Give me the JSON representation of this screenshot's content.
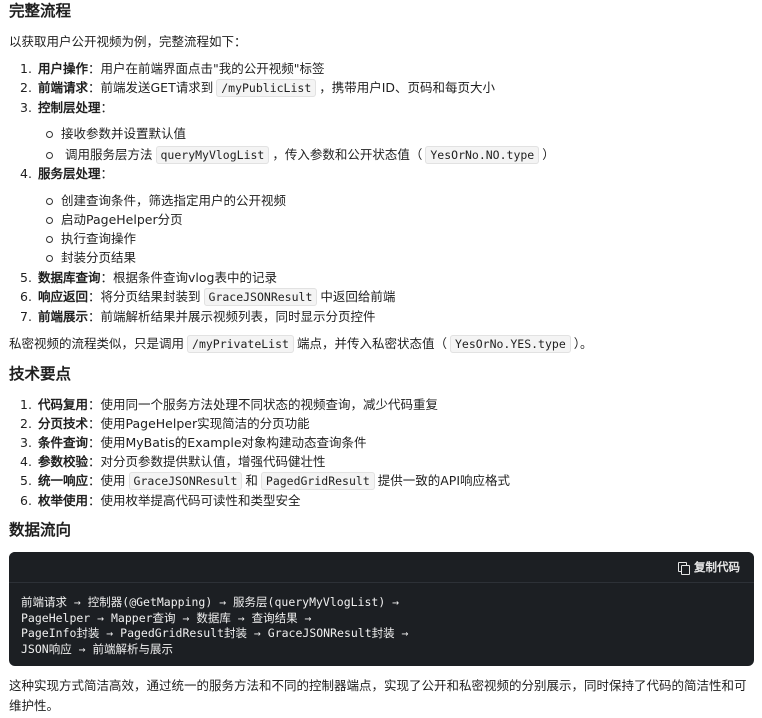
{
  "sections": {
    "flow_title": "完整流程",
    "tech_title": "技术要点",
    "data_title": "数据流向"
  },
  "intro": "以获取用户公开视频为例，完整流程如下：",
  "steps": [
    {
      "num": "1.",
      "label": "用户操作",
      "text": "：用户在前端界面点击\"我的公开视频\"标签"
    },
    {
      "num": "2.",
      "label": "前端请求",
      "pre": "：前端发送GET请求到",
      "code": "/myPublicList",
      "post": "，携带用户ID、页码和每页大小"
    },
    {
      "num": "3.",
      "label": "控制层处理",
      "text": "："
    },
    {
      "num": "4.",
      "label": "服务层处理",
      "text": "："
    },
    {
      "num": "5.",
      "label": "数据库查询",
      "text": "：根据条件查询vlog表中的记录"
    },
    {
      "num": "6.",
      "label": "响应返回",
      "pre": "：将分页结果封装到",
      "code": "GraceJSONResult",
      "post": "中返回给前端"
    },
    {
      "num": "7.",
      "label": "前端展示",
      "text": "：前端解析结果并展示视频列表，同时显示分页控件"
    }
  ],
  "controller_sub": {
    "item1": "接收参数并设置默认值",
    "item2_pre": "调用服务层方法",
    "item2_code1": "queryMyVlogList",
    "item2_mid": "，传入参数和公开状态值（",
    "item2_code2": "YesOrNo.NO.type",
    "item2_post": "）"
  },
  "service_sub": [
    "创建查询条件，筛选指定用户的公开视频",
    "启动PageHelper分页",
    "执行查询操作",
    "封装分页结果"
  ],
  "private_note": {
    "pre": "私密视频的流程类似，只是调用",
    "code1": "/myPrivateList",
    "mid": "端点，并传入私密状态值（",
    "code2": "YesOrNo.YES.type",
    "post": "）。"
  },
  "tech_points": [
    {
      "num": "1.",
      "label": "代码复用",
      "text": "：使用同一个服务方法处理不同状态的视频查询，减少代码重复"
    },
    {
      "num": "2.",
      "label": "分页技术",
      "text": "：使用PageHelper实现简洁的分页功能"
    },
    {
      "num": "3.",
      "label": "条件查询",
      "text": "：使用MyBatis的Example对象构建动态查询条件"
    },
    {
      "num": "4.",
      "label": "参数校验",
      "text": "：对分页参数提供默认值，增强代码健壮性"
    },
    {
      "num": "5.",
      "label": "统一响应",
      "pre": "：使用",
      "code1": "GraceJSONResult",
      "mid": "和",
      "code2": "PagedGridResult",
      "post": "提供一致的API响应格式"
    },
    {
      "num": "6.",
      "label": "枚举使用",
      "text": "：使用枚举提高代码可读性和类型安全"
    }
  ],
  "code_block": {
    "copy_label": "复制代码",
    "content": "前端请求 → 控制器(@GetMapping) → 服务层(queryMyVlogList) →\nPageHelper → Mapper查询 → 数据库 → 查询结果 →\nPageInfo封装 → PagedGridResult封装 → GraceJSONResult封装 →\nJSON响应 → 前端解析与展示"
  },
  "closing": "这种实现方式简洁高效，通过统一的服务方法和不同的控制器端点，实现了公开和私密视频的分别展示，同时保持了代码的简洁性和可维护性。",
  "icons": {
    "copy": "copy-icon"
  }
}
